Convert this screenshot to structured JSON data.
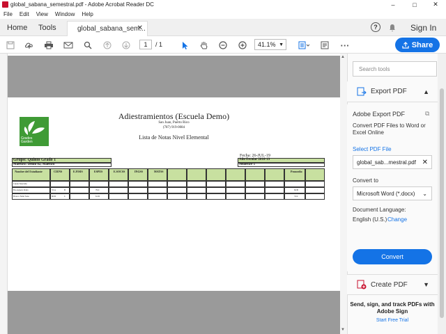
{
  "window": {
    "title": "global_sabana_semestral.pdf - Adobe Acrobat Reader DC",
    "minimize": "–",
    "maximize": "□",
    "close": "✕"
  },
  "menu": [
    "File",
    "Edit",
    "View",
    "Window",
    "Help"
  ],
  "tabs": {
    "home": "Home",
    "tools": "Tools",
    "document": "global_sabana_sem...",
    "close": "✕"
  },
  "header_right": {
    "help": "?",
    "bell": "🔔",
    "signin": "Sign In"
  },
  "toolbar": {
    "page_current": "1",
    "page_total": "/ 1",
    "zoom": "41.1%",
    "share": "Share"
  },
  "pdf": {
    "title": "Adiestramientos (Escuela Demo)",
    "city": "San Juan, Puerto Rico",
    "phone": "(787) 919-0084",
    "list_title": "Lista de Notas Nivel Elemental",
    "logo_text1": "Grades",
    "logo_text2": "Garden",
    "fecha": "Fecha: 26-JUL-19",
    "grupo": "Grupo: Quinto Grado 1",
    "maestro": "Maestro: Demo 02, Maestro",
    "ano": "Año Escolar 2018-19",
    "semestre": "Semestre 1",
    "student_col": "Nombre del Estudiante",
    "subjects": [
      "CIENS",
      "E.FISIS",
      "ESPES",
      "E.SOCSS",
      "INGSS",
      "MATSS"
    ],
    "promedio": "Promedio",
    "students": [
      {
        "name": "Cunde Nancisha"
      },
      {
        "name": "Bos Agnelo Pedro",
        "grade1": "55/A",
        "grade2": "B",
        "grade3": "79/C",
        "avg": "82/B"
      },
      {
        "name": "Bronco Neleí Sana",
        "grade1": "60/D",
        "grade2": "C",
        "grade3": "61/D",
        "avg": "74/C"
      }
    ]
  },
  "sidebar": {
    "search_placeholder": "Search tools",
    "export_pdf": "Export PDF",
    "adobe_export": "Adobe Export PDF",
    "desc": "Convert PDF Files to Word or Excel Online",
    "select_pdf": "Select PDF File",
    "file": "global_sab...mestral.pdf",
    "convert_to": "Convert to",
    "format": "Microsoft Word (*.docx)",
    "lang_label": "Document Language:",
    "lang": "English (U.S.)",
    "change": "Change",
    "convert": "Convert",
    "create_pdf": "Create PDF",
    "promo": "Send, sign, and track PDFs with Adobe Sign",
    "trial": "Start Free Trial"
  },
  "colors": {
    "accent": "#1473e6",
    "pdf_red": "#c8102e",
    "green": "#3f9b35",
    "table_green": "#c8e0a0"
  }
}
